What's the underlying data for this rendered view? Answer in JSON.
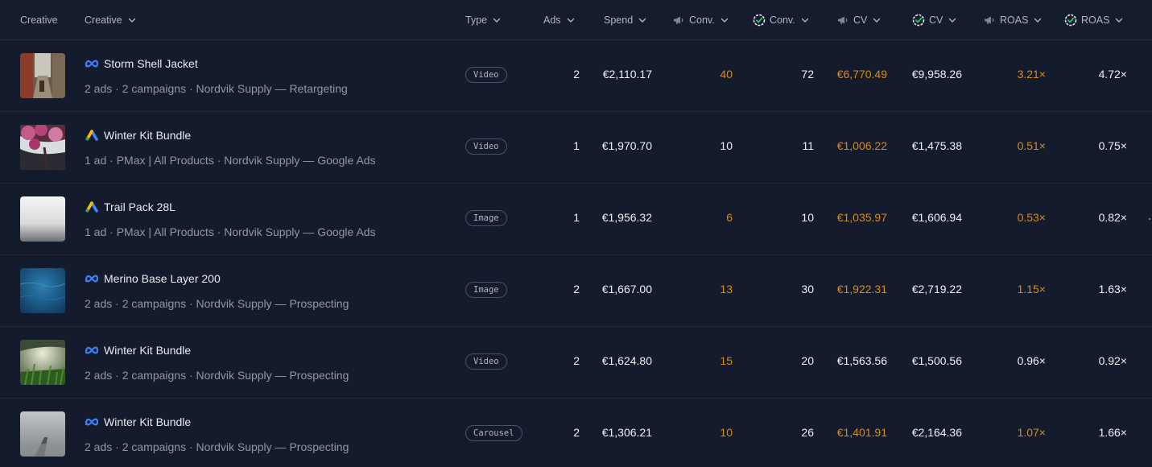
{
  "header": {
    "col_creative_static": "Creative",
    "col_creative": "Creative",
    "col_type": "Type",
    "col_ads": "Ads",
    "col_spend": "Spend",
    "col_conv_platform": "Conv.",
    "col_conv_verified": "Conv.",
    "col_cv_platform": "CV",
    "col_cv_verified": "CV",
    "col_roas_platform": "ROAS",
    "col_roas_verified": "ROAS"
  },
  "colors": {
    "background": "#141b2d",
    "platform_metric": "#d98a1c",
    "verified_metric": "#eef0f4",
    "meta_blue": "#3b82f6",
    "verified_green": "#22c55e"
  },
  "rows": [
    {
      "thumb_icon": "alley-photo",
      "platform_icon": "meta-icon",
      "title": "Storm Shell Jacket",
      "subtitle": "2 ads · 2 campaigns · Nordvik Supply — Retargeting",
      "type": "Video",
      "ads": "2",
      "spend": "€2,110.17",
      "conv_platform": "40",
      "conv_verified": "72",
      "cv_platform": "€6,770.49",
      "cv_verified": "€9,958.26",
      "roas_platform": "3.21×",
      "roas_verified": "4.72×",
      "cv_platform_color": "orange",
      "roas_platform_color": "orange"
    },
    {
      "thumb_icon": "blossom-photo",
      "platform_icon": "google-ads-icon",
      "title": "Winter Kit Bundle",
      "subtitle": "1 ad · PMax | All Products · Nordvik Supply — Google Ads",
      "type": "Video",
      "ads": "1",
      "spend": "€1,970.70",
      "conv_platform": "10",
      "conv_verified": "11",
      "cv_platform": "€1,006.22",
      "cv_verified": "€1,475.38",
      "roas_platform": "0.51×",
      "roas_verified": "0.75×",
      "cv_platform_color": "orange",
      "roas_platform_color": "orange"
    },
    {
      "thumb_icon": "fog-photo",
      "platform_icon": "google-ads-icon",
      "title": "Trail Pack 28L",
      "subtitle": "1 ad · PMax | All Products · Nordvik Supply — Google Ads",
      "type": "Image",
      "ads": "1",
      "spend": "€1,956.32",
      "conv_platform": "6",
      "conv_verified": "10",
      "cv_platform": "€1,035.97",
      "cv_verified": "€1,606.94",
      "roas_platform": "0.53×",
      "roas_verified": "0.82×",
      "cv_platform_color": "orange",
      "roas_platform_color": "orange"
    },
    {
      "thumb_icon": "water-photo",
      "platform_icon": "meta-icon",
      "title": "Merino Base Layer 200",
      "subtitle": "2 ads · 2 campaigns · Nordvik Supply — Prospecting",
      "type": "Image",
      "ads": "2",
      "spend": "€1,667.00",
      "conv_platform": "13",
      "conv_verified": "30",
      "cv_platform": "€1,922.31",
      "cv_verified": "€2,719.22",
      "roas_platform": "1.15×",
      "roas_verified": "1.63×",
      "cv_platform_color": "orange",
      "roas_platform_color": "orange"
    },
    {
      "thumb_icon": "grass-photo",
      "platform_icon": "meta-icon",
      "title": "Winter Kit Bundle",
      "subtitle": "2 ads · 2 campaigns · Nordvik Supply — Prospecting",
      "type": "Video",
      "ads": "2",
      "spend": "€1,624.80",
      "conv_platform": "15",
      "conv_verified": "20",
      "cv_platform": "€1,563.56",
      "cv_verified": "€1,500.56",
      "roas_platform": "0.96×",
      "roas_verified": "0.92×",
      "cv_platform_color": "white",
      "roas_platform_color": "white"
    },
    {
      "thumb_icon": "pier-photo",
      "platform_icon": "meta-icon",
      "title": "Winter Kit Bundle",
      "subtitle": "2 ads · 2 campaigns · Nordvik Supply — Prospecting",
      "type": "Carousel",
      "ads": "2",
      "spend": "€1,306.21",
      "conv_platform": "10",
      "conv_verified": "26",
      "cv_platform": "€1,401.91",
      "cv_verified": "€2,164.36",
      "roas_platform": "1.07×",
      "roas_verified": "1.66×",
      "cv_platform_color": "orange",
      "roas_platform_color": "orange"
    }
  ]
}
